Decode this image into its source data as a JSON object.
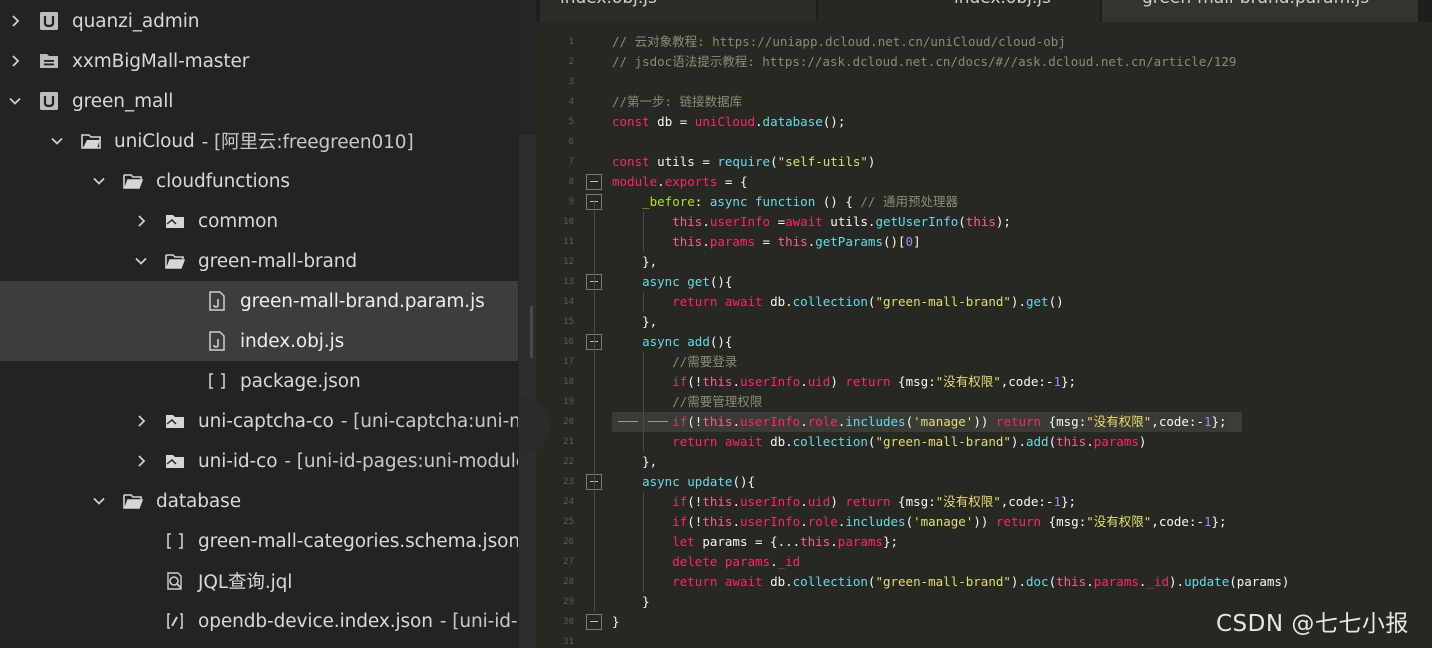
{
  "sidebar": {
    "items": [
      {
        "name": "quanzi_admin",
        "suffix": "",
        "icon": "unicloud-project-icon",
        "chevron": "right",
        "indent": 0,
        "selected": false
      },
      {
        "name": "xxmBigMall-master",
        "suffix": "",
        "icon": "project-icon",
        "chevron": "right",
        "indent": 0,
        "selected": false
      },
      {
        "name": "green_mall",
        "suffix": "",
        "icon": "unicloud-project-icon",
        "chevron": "down",
        "indent": 0,
        "selected": false
      },
      {
        "name": "uniCloud",
        "suffix": "- [阿里云:freegreen010]",
        "icon": "cloud-folder-icon",
        "chevron": "down",
        "indent": 1,
        "selected": false
      },
      {
        "name": "cloudfunctions",
        "suffix": "",
        "icon": "folder-open-icon",
        "chevron": "down",
        "indent": 2,
        "selected": false
      },
      {
        "name": "common",
        "suffix": "",
        "icon": "folder-icon",
        "chevron": "right",
        "indent": 3,
        "selected": false
      },
      {
        "name": "green-mall-brand",
        "suffix": "",
        "icon": "folder-open-icon",
        "chevron": "down",
        "indent": 3,
        "selected": false
      },
      {
        "name": "green-mall-brand.param.js",
        "suffix": "",
        "icon": "js-file-icon",
        "chevron": "none",
        "indent": 4,
        "selected": true
      },
      {
        "name": "index.obj.js",
        "suffix": "",
        "icon": "js-file-icon",
        "chevron": "none",
        "indent": 4,
        "selected": true
      },
      {
        "name": "package.json",
        "suffix": "",
        "icon": "json-file-icon",
        "chevron": "none",
        "indent": 4,
        "selected": false
      },
      {
        "name": "uni-captcha-co",
        "suffix": "- [uni-captcha:uni-mo",
        "icon": "folder-icon",
        "chevron": "right",
        "indent": 3,
        "selected": false
      },
      {
        "name": "uni-id-co",
        "suffix": "- [uni-id-pages:uni-module",
        "icon": "folder-icon",
        "chevron": "right",
        "indent": 3,
        "selected": false
      },
      {
        "name": "database",
        "suffix": "",
        "icon": "folder-open-icon",
        "chevron": "down",
        "indent": 2,
        "selected": false
      },
      {
        "name": "green-mall-categories.schema.json",
        "suffix": "",
        "icon": "json-file-icon",
        "chevron": "none",
        "indent": 3,
        "selected": false
      },
      {
        "name": "JQL查询.jql",
        "suffix": "",
        "icon": "jql-file-icon",
        "chevron": "none",
        "indent": 3,
        "selected": false
      },
      {
        "name": "opendb-device.index.json",
        "suffix": "- [uni-id-pa",
        "icon": "index-json-file-icon",
        "chevron": "none",
        "indent": 3,
        "selected": false
      }
    ]
  },
  "editor": {
    "tabs": [
      {
        "label": "index.obj.js"
      },
      {
        "label": "index.obj.js"
      },
      {
        "label": "green-mall-brand.param.js"
      }
    ],
    "lines": [
      {
        "n": "1",
        "fold": false,
        "hl": false,
        "tokens": [
          [
            "cm",
            "// 云对象教程: https://uniapp.dcloud.net.cn/uniCloud/cloud-obj"
          ]
        ]
      },
      {
        "n": "2",
        "fold": false,
        "hl": false,
        "tokens": [
          [
            "cm",
            "// jsdoc语法提示教程: https://ask.dcloud.net.cn/docs/#//ask.dcloud.net.cn/article/129"
          ]
        ]
      },
      {
        "n": "3",
        "fold": false,
        "hl": false,
        "tokens": []
      },
      {
        "n": "4",
        "fold": false,
        "hl": false,
        "tokens": [
          [
            "cm",
            "//第一步: 链接数据库"
          ]
        ]
      },
      {
        "n": "5",
        "fold": false,
        "hl": false,
        "tokens": [
          [
            "kw",
            "const"
          ],
          [
            "pl",
            " db = "
          ],
          [
            "kw",
            "uniCloud"
          ],
          [
            "pl",
            "."
          ],
          [
            "fn",
            "database"
          ],
          [
            "pl",
            "();"
          ]
        ]
      },
      {
        "n": "6",
        "fold": false,
        "hl": false,
        "tokens": []
      },
      {
        "n": "7",
        "fold": false,
        "hl": false,
        "tokens": [
          [
            "kw",
            "const"
          ],
          [
            "pl",
            " utils = "
          ],
          [
            "fn",
            "require"
          ],
          [
            "pl",
            "("
          ],
          [
            "st",
            "\"self-utils\""
          ],
          [
            "pl",
            ")"
          ]
        ]
      },
      {
        "n": "8",
        "fold": true,
        "hl": false,
        "tokens": [
          [
            "kw",
            "module"
          ],
          [
            "pl",
            "."
          ],
          [
            "kw",
            "exports"
          ],
          [
            "pl",
            " = {"
          ]
        ]
      },
      {
        "n": "9",
        "fold": true,
        "hl": false,
        "tokens": [
          [
            "pl",
            "    "
          ],
          [
            "pr",
            "_before"
          ],
          [
            "pl",
            ": "
          ],
          [
            "fn",
            "async function"
          ],
          [
            "pl",
            " () { "
          ],
          [
            "cm",
            "// 通用预处理器"
          ]
        ]
      },
      {
        "n": "10",
        "fold": false,
        "hl": false,
        "tokens": [
          [
            "pl",
            "        "
          ],
          [
            "th",
            "this"
          ],
          [
            "pl",
            "."
          ],
          [
            "kw",
            "userInfo"
          ],
          [
            "pl",
            " ="
          ],
          [
            "kw",
            "await"
          ],
          [
            "pl",
            " utils."
          ],
          [
            "fn",
            "getUserInfo"
          ],
          [
            "pl",
            "("
          ],
          [
            "th",
            "this"
          ],
          [
            "pl",
            ");"
          ]
        ]
      },
      {
        "n": "11",
        "fold": false,
        "hl": false,
        "tokens": [
          [
            "pl",
            "        "
          ],
          [
            "th",
            "this"
          ],
          [
            "pl",
            "."
          ],
          [
            "kw",
            "params"
          ],
          [
            "pl",
            " = "
          ],
          [
            "th",
            "this"
          ],
          [
            "pl",
            "."
          ],
          [
            "fn",
            "getParams"
          ],
          [
            "pl",
            "()["
          ],
          [
            "nm",
            "0"
          ],
          [
            "pl",
            "]"
          ]
        ]
      },
      {
        "n": "12",
        "fold": false,
        "hl": false,
        "tokens": [
          [
            "pl",
            "    },"
          ]
        ]
      },
      {
        "n": "13",
        "fold": true,
        "hl": false,
        "tokens": [
          [
            "pl",
            "    "
          ],
          [
            "fn",
            "async"
          ],
          [
            "pl",
            " "
          ],
          [
            "fn",
            "get"
          ],
          [
            "pl",
            "(){"
          ]
        ]
      },
      {
        "n": "14",
        "fold": false,
        "hl": false,
        "tokens": [
          [
            "pl",
            "        "
          ],
          [
            "kw",
            "return"
          ],
          [
            "pl",
            " "
          ],
          [
            "kw",
            "await"
          ],
          [
            "pl",
            " db."
          ],
          [
            "fn",
            "collection"
          ],
          [
            "pl",
            "("
          ],
          [
            "st",
            "\"green-mall-brand\""
          ],
          [
            "pl",
            ")."
          ],
          [
            "fn",
            "get"
          ],
          [
            "pl",
            "()"
          ]
        ]
      },
      {
        "n": "15",
        "fold": false,
        "hl": false,
        "tokens": [
          [
            "pl",
            "    },"
          ]
        ]
      },
      {
        "n": "16",
        "fold": true,
        "hl": false,
        "tokens": [
          [
            "pl",
            "    "
          ],
          [
            "fn",
            "async"
          ],
          [
            "pl",
            " "
          ],
          [
            "fn",
            "add"
          ],
          [
            "pl",
            "(){"
          ]
        ]
      },
      {
        "n": "17",
        "fold": false,
        "hl": false,
        "tokens": [
          [
            "pl",
            "        "
          ],
          [
            "cm",
            "//需要登录"
          ]
        ]
      },
      {
        "n": "18",
        "fold": false,
        "hl": false,
        "tokens": [
          [
            "pl",
            "        "
          ],
          [
            "kw",
            "if"
          ],
          [
            "pl",
            "(!"
          ],
          [
            "th",
            "this"
          ],
          [
            "pl",
            "."
          ],
          [
            "kw",
            "userInfo"
          ],
          [
            "pl",
            "."
          ],
          [
            "kw",
            "uid"
          ],
          [
            "pl",
            ") "
          ],
          [
            "kw",
            "return"
          ],
          [
            "pl",
            " {msg:"
          ],
          [
            "st",
            "\"没有权限\""
          ],
          [
            "pl",
            ",code:-"
          ],
          [
            "nm",
            "1"
          ],
          [
            "pl",
            "};"
          ]
        ]
      },
      {
        "n": "19",
        "fold": false,
        "hl": false,
        "tokens": [
          [
            "pl",
            "        "
          ],
          [
            "cm",
            "//需要管理权限"
          ]
        ]
      },
      {
        "n": "20",
        "fold": false,
        "hl": true,
        "tokens": [
          [
            "pl",
            "        "
          ],
          [
            "kw",
            "if"
          ],
          [
            "pl",
            "(!"
          ],
          [
            "th",
            "this"
          ],
          [
            "pl",
            "."
          ],
          [
            "kw",
            "userInfo"
          ],
          [
            "pl",
            "."
          ],
          [
            "kw",
            "role"
          ],
          [
            "pl",
            "."
          ],
          [
            "fn",
            "includes"
          ],
          [
            "pl",
            "("
          ],
          [
            "st",
            "'manage'"
          ],
          [
            "pl",
            ")) "
          ],
          [
            "kw",
            "return"
          ],
          [
            "pl",
            " {msg:"
          ],
          [
            "st",
            "\"没有权限\""
          ],
          [
            "pl",
            ",code:-"
          ],
          [
            "nm",
            "1"
          ],
          [
            "pl",
            "};"
          ]
        ]
      },
      {
        "n": "21",
        "fold": false,
        "hl": false,
        "tokens": [
          [
            "pl",
            "        "
          ],
          [
            "kw",
            "return"
          ],
          [
            "pl",
            " "
          ],
          [
            "kw",
            "await"
          ],
          [
            "pl",
            " db."
          ],
          [
            "fn",
            "collection"
          ],
          [
            "pl",
            "("
          ],
          [
            "st",
            "\"green-mall-brand\""
          ],
          [
            "pl",
            ")."
          ],
          [
            "fn",
            "add"
          ],
          [
            "pl",
            "("
          ],
          [
            "th",
            "this"
          ],
          [
            "pl",
            "."
          ],
          [
            "kw",
            "params"
          ],
          [
            "pl",
            ")"
          ]
        ]
      },
      {
        "n": "22",
        "fold": false,
        "hl": false,
        "tokens": [
          [
            "pl",
            "    },"
          ]
        ]
      },
      {
        "n": "23",
        "fold": true,
        "hl": false,
        "tokens": [
          [
            "pl",
            "    "
          ],
          [
            "fn",
            "async"
          ],
          [
            "pl",
            " "
          ],
          [
            "fn",
            "update"
          ],
          [
            "pl",
            "(){"
          ]
        ]
      },
      {
        "n": "24",
        "fold": false,
        "hl": false,
        "tokens": [
          [
            "pl",
            "        "
          ],
          [
            "kw",
            "if"
          ],
          [
            "pl",
            "(!"
          ],
          [
            "th",
            "this"
          ],
          [
            "pl",
            "."
          ],
          [
            "kw",
            "userInfo"
          ],
          [
            "pl",
            "."
          ],
          [
            "kw",
            "uid"
          ],
          [
            "pl",
            ") "
          ],
          [
            "kw",
            "return"
          ],
          [
            "pl",
            " {msg:"
          ],
          [
            "st",
            "\"没有权限\""
          ],
          [
            "pl",
            ",code:-"
          ],
          [
            "nm",
            "1"
          ],
          [
            "pl",
            "};"
          ]
        ]
      },
      {
        "n": "25",
        "fold": false,
        "hl": false,
        "tokens": [
          [
            "pl",
            "        "
          ],
          [
            "kw",
            "if"
          ],
          [
            "pl",
            "(!"
          ],
          [
            "th",
            "this"
          ],
          [
            "pl",
            "."
          ],
          [
            "kw",
            "userInfo"
          ],
          [
            "pl",
            "."
          ],
          [
            "kw",
            "role"
          ],
          [
            "pl",
            "."
          ],
          [
            "fn",
            "includes"
          ],
          [
            "pl",
            "("
          ],
          [
            "st",
            "'manage'"
          ],
          [
            "pl",
            ")) "
          ],
          [
            "kw",
            "return"
          ],
          [
            "pl",
            " {msg:"
          ],
          [
            "st",
            "\"没有权限\""
          ],
          [
            "pl",
            ",code:-"
          ],
          [
            "nm",
            "1"
          ],
          [
            "pl",
            "};"
          ]
        ]
      },
      {
        "n": "26",
        "fold": false,
        "hl": false,
        "tokens": [
          [
            "pl",
            "        "
          ],
          [
            "kw",
            "let"
          ],
          [
            "pl",
            " params = {..."
          ],
          [
            "th",
            "this"
          ],
          [
            "pl",
            "."
          ],
          [
            "kw",
            "params"
          ],
          [
            "pl",
            "};"
          ]
        ]
      },
      {
        "n": "27",
        "fold": false,
        "hl": false,
        "tokens": [
          [
            "pl",
            "        "
          ],
          [
            "kw",
            "delete"
          ],
          [
            "pl",
            " "
          ],
          [
            "kw",
            "params"
          ],
          [
            "pl",
            "."
          ],
          [
            "kw",
            "_id"
          ]
        ]
      },
      {
        "n": "28",
        "fold": false,
        "hl": false,
        "tokens": [
          [
            "pl",
            "        "
          ],
          [
            "kw",
            "return"
          ],
          [
            "pl",
            " "
          ],
          [
            "kw",
            "await"
          ],
          [
            "pl",
            " db."
          ],
          [
            "fn",
            "collection"
          ],
          [
            "pl",
            "("
          ],
          [
            "st",
            "\"green-mall-brand\""
          ],
          [
            "pl",
            ")."
          ],
          [
            "fn",
            "doc"
          ],
          [
            "pl",
            "("
          ],
          [
            "th",
            "this"
          ],
          [
            "pl",
            "."
          ],
          [
            "kw",
            "params"
          ],
          [
            "pl",
            "."
          ],
          [
            "kw",
            "_id"
          ],
          [
            "pl",
            ")."
          ],
          [
            "fn",
            "update"
          ],
          [
            "pl",
            "(params)"
          ]
        ]
      },
      {
        "n": "29",
        "fold": false,
        "hl": false,
        "tokens": [
          [
            "pl",
            "    }"
          ]
        ]
      },
      {
        "n": "30",
        "fold": true,
        "hl": false,
        "tokens": [
          [
            "pl",
            "}"
          ]
        ]
      },
      {
        "n": "31",
        "fold": false,
        "hl": false,
        "tokens": []
      }
    ]
  },
  "watermark": "CSDN @七七小报",
  "colors": {
    "sidebar_bg": "#222322",
    "selected_row": "#3c3d3c",
    "editor_bg": "#272822",
    "keyword": "#f92672",
    "function": "#66d9ef",
    "string": "#e6db74",
    "number": "#ae81ff",
    "comment": "#8b8a7c",
    "property": "#a6e22e"
  }
}
